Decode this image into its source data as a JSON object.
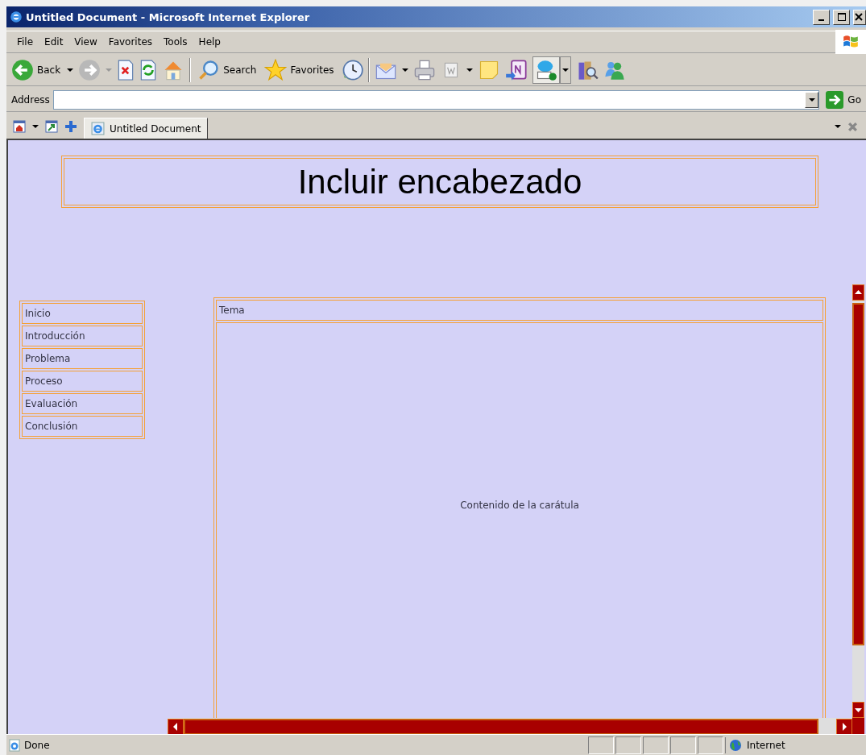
{
  "window": {
    "title": "Untitled Document - Microsoft Internet Explorer"
  },
  "menu": [
    {
      "label": "File"
    },
    {
      "label": "Edit"
    },
    {
      "label": "View"
    },
    {
      "label": "Favorites"
    },
    {
      "label": "Tools"
    },
    {
      "label": "Help"
    }
  ],
  "toolbar": {
    "back": "Back",
    "search": "Search",
    "favorites": "Favorites"
  },
  "address": {
    "label": "Address",
    "go": "Go"
  },
  "tabs": [
    {
      "label": "Untitled Document",
      "selected": true
    }
  ],
  "page": {
    "header": "Incluir encabezado",
    "nav": [
      {
        "label": "Inicio"
      },
      {
        "label": "Introducción"
      },
      {
        "label": "Problema"
      },
      {
        "label": "Proceso"
      },
      {
        "label": "Evaluación"
      },
      {
        "label": "Conclusión"
      }
    ],
    "topic": "Tema",
    "content": "Contenido de la carátula"
  },
  "status_bar": {
    "text": "Done",
    "zone": "Internet"
  }
}
